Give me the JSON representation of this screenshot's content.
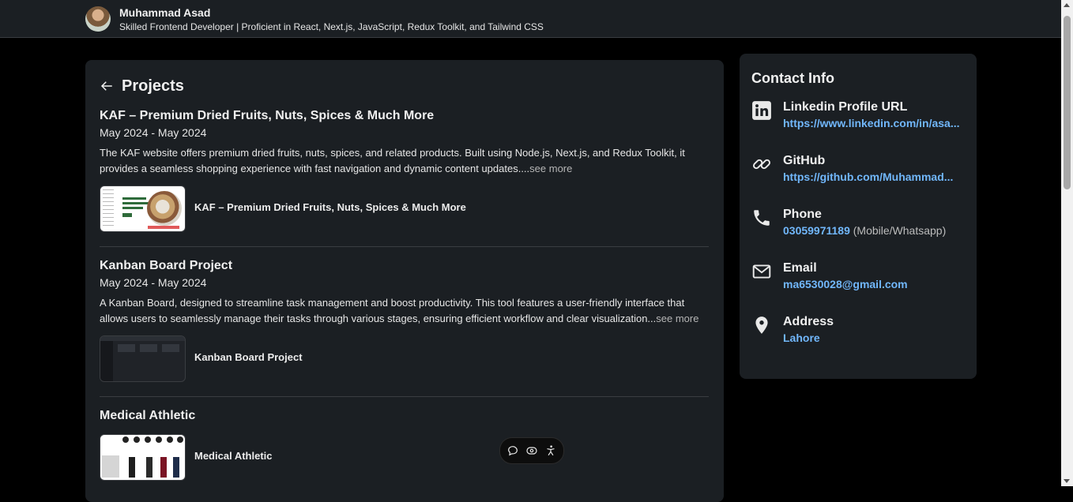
{
  "header": {
    "name": "Muhammad Asad",
    "headline": "Skilled Frontend Developer | Proficient in React, Next.js, JavaScript, Redux Toolkit, and Tailwind CSS"
  },
  "projects_section": {
    "title": "Projects",
    "see_more_label": "see more",
    "items": [
      {
        "title": "KAF – Premium Dried Fruits, Nuts, Spices & Much More",
        "date": "May 2024 - May 2024",
        "description": "The KAF website offers premium dried fruits, nuts, spices, and related products. Built using Node.js, Next.js, and Redux Toolkit, it provides a seamless shopping experience with fast navigation and dynamic content updates....",
        "media_label": "KAF – Premium Dried Fruits, Nuts, Spices & Much More"
      },
      {
        "title": "Kanban Board Project",
        "date": "May 2024 - May 2024",
        "description": "A Kanban Board, designed to streamline task management and boost productivity. This tool features a user-friendly interface that allows users to seamlessly manage their tasks through various stages, ensuring efficient workflow and clear visualization...",
        "media_label": "Kanban Board Project"
      },
      {
        "title": "Medical Athletic",
        "media_label": "Medical Athletic"
      }
    ]
  },
  "contact_info": {
    "title": "Contact Info",
    "items": [
      {
        "label": "Linkedin Profile URL",
        "value": "https://www.linkedin.com/in/asa...",
        "icon": "linkedin-icon"
      },
      {
        "label": "GitHub",
        "value": "https://github.com/Muhammad...",
        "icon": "link-icon"
      },
      {
        "label": "Phone",
        "value": "03059971189",
        "note": " (Mobile/Whatsapp)",
        "icon": "phone-icon"
      },
      {
        "label": "Email",
        "value": "ma6530028@gmail.com",
        "icon": "email-icon"
      },
      {
        "label": "Address",
        "value": "Lahore",
        "icon": "location-pin-icon"
      }
    ]
  },
  "colors": {
    "background": "#000000",
    "card": "#1b1f23",
    "link": "#71b7fb"
  }
}
